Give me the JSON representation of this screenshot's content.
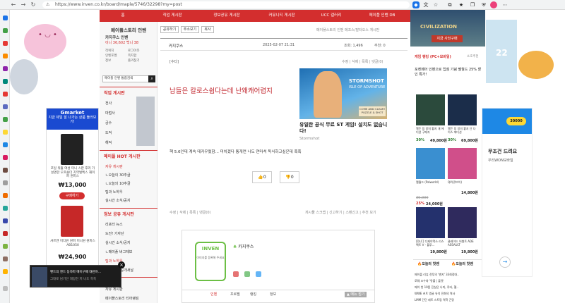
{
  "browser": {
    "url": "https://www.inven.co.kr/board/maple/5746/32298?my=post",
    "url_host": "www.inven.co.kr",
    "url_path": "/board/maple/5746/322981?my=post"
  },
  "topnav": {
    "items": [
      "홈",
      "직업 게시판",
      "정보공유 게시판",
      "커뮤니티 게시판",
      "UCC 갤러리",
      "메이플 인벤 DB"
    ]
  },
  "top_ad": {
    "title": "CIVILIZATION",
    "sub": "지금 사전구매"
  },
  "left_nav": {
    "title": "메이플스토리 인벤",
    "user_line": "카지쿠스 인벤",
    "points_line": "이니 36,602   백니 38",
    "small_links": [
      "작위지",
      "로그아웃",
      "인벤포켓",
      "쪽지함",
      "정보",
      "즐겨찾기"
    ],
    "search_placeholder": "메이플 인벤 통합검색",
    "section1": "직업 게시판",
    "section1_items": [
      "전사",
      "마법사",
      "궁수",
      "도적",
      "해적"
    ],
    "section2": "메이플 HOT 게시판",
    "section2_items": [
      "자유 게시판",
      "ㄴ오늘의 30추글",
      "ㄴ오늘의 10추글",
      "팁과 노하우",
      "실시간 소식/공지"
    ],
    "section3": "정보 공유 게시판",
    "section3_items": [
      "리포터 뉴스",
      "도전! 기자단",
      "실시간 소식/공지",
      "ㄴ메이플 버그제보",
      "팁과 노하우",
      "퀀텀지 뉴/공개새날"
    ],
    "section4_items": [
      "자유 게시판",
      "메이플스토리 티어랭킹"
    ]
  },
  "post": {
    "buttons": [
      "공유하기",
      "주소보기",
      "복사"
    ],
    "breadcrumb": "메이플스토리 인벤 메조스/말타오스 게시판",
    "author": "카지쿠스",
    "date": "2025-02-07 21:31",
    "views": "조회: 1,496",
    "recommend": "추천: 0",
    "subject_tag": "[수다]",
    "post_actions": "수정 | 삭제 | 목록 | 댓글(0)",
    "title": "남들은 칼로스쉽다는데 난왜캐어렵지",
    "body": "핵 5.6인데 계속 데카우렸함... 미치겠다 통개런 나도 연마석 독식하고싶은데 흑흑",
    "up_count": "0",
    "down_count": "0",
    "footer_left": "수정 | 삭제 | 목록 | 댓글(0)",
    "footer_right": "게시물 스크랩 | 신고하기 | 스펜신고 | 추천 보기",
    "ad_title": "유일한 공식 무료 ST 게임! 설치도 없습니다!",
    "ad_source": "Stormshot",
    "ad_brand": "STORMSHOT",
    "ad_tagline": "ISLE OF ADVENTURE",
    "ad_badge": "COME AND CLEAR! PUZZLE & SHOT",
    "profile_brand": "INVEN",
    "profile_caption": "이미지를 등록해 주세요",
    "profile_name": "카지쿠스",
    "profile_tabs": [
      "인벤",
      "프로필",
      "랭킹",
      "정보"
    ],
    "profile_more": "▲ 메뉴 접기"
  },
  "left_ad": {
    "brand": "Gmarket",
    "headline": "지금 제일 잘 나가는 상품 둘러보기!",
    "item1_desc": "포일 워홀 여성 미니 스판 후커 가 설명한 오프숄더 지역벌벡스 재미퍼 원피스",
    "item1_price": "₩13,000",
    "buy": "구매하기",
    "item2_desc": "샤르엔 미디원 원피 미니원 원피스 AB1050",
    "item2_price": "₩24,900"
  },
  "right": {
    "ad_num": "22",
    "shop_title": "게임 랭킹 (PC+모바일)",
    "shop_more": "소호추천",
    "shop_headline": "포켓페어 인벤으로 입점 기념 팰월드 25% 할인 특가!",
    "products": [
      {
        "name": "앨든 링 방의 황지 개 에디션 구매자",
        "discount": "30%",
        "price": "49,800원"
      },
      {
        "name": "엘든 링 방의 황지 단 다이스 에디션",
        "discount": "30%",
        "price": "69,800원"
      },
      {
        "name": "팰월드 (Palworld)",
        "discount": "",
        "price": "14,800원"
      },
      {
        "name": "QV(큐브이)",
        "discount": "",
        "price": "30,000"
      },
      {
        "name": "[DLC] 디제이맥스 리스펙트 V - 블루...",
        "discount": "25%",
        "price": "19,800원"
      },
      {
        "name": "클레이드 어썰트 ADE ASSAULT",
        "discount": "",
        "price": "19,800원"
      }
    ],
    "strip_price": "24,000원",
    "today_tabs": [
      "오늘의 핫벤",
      "오늘의 핫벤"
    ],
    "today_list": [
      "메이플 리뷰 전투의 '벤지' 33회정대..",
      "로웨 조수와 '뮤를 | 플렛",
      "메이 첫 10쯤 진실은 나미, 루터, 헬..",
      "WWE 커트 앵글 유석 진화의 역사",
      "LMM 간단 레트 스트링 역학 곤랑"
    ],
    "far_ad_headline": "무조건 드려요",
    "far_ad_sub": "우리WON모바일",
    "far_ad_num": "30000"
  },
  "video": {
    "title": "팬드의 엔드 동자파 메이구배 대련하...",
    "sub": "그대로 남기던 대답진 저 나도 흑흑"
  }
}
